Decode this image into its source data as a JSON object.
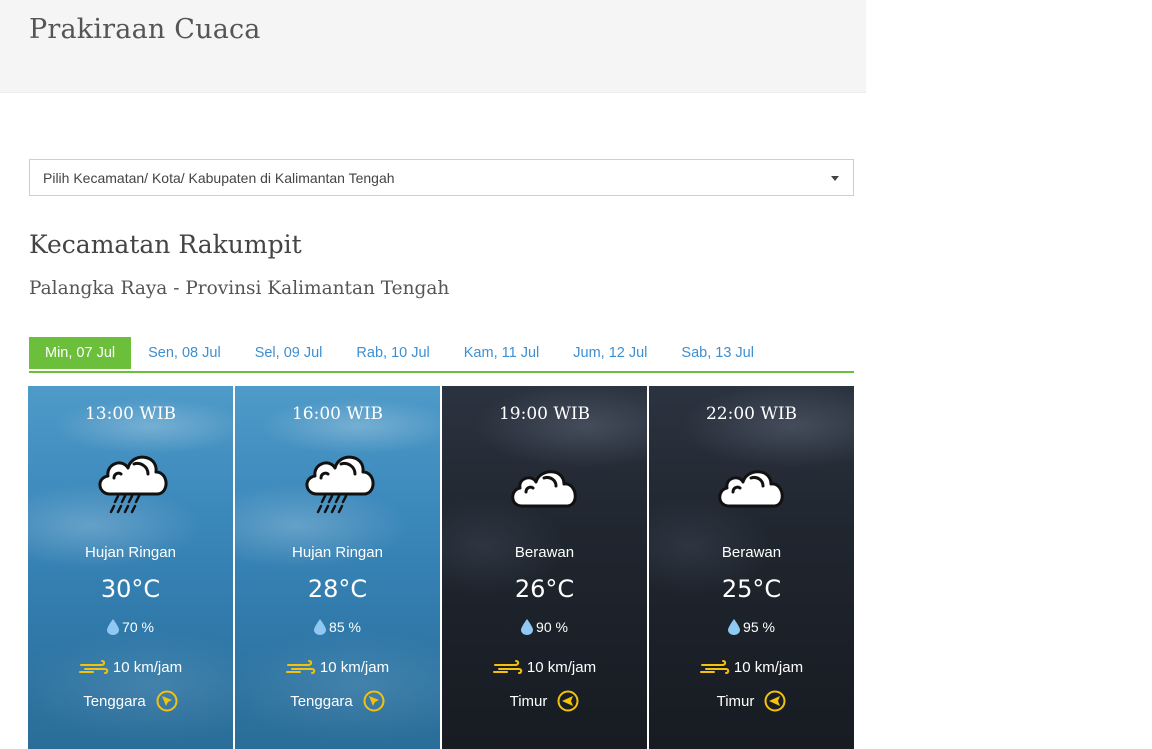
{
  "header": {
    "title": "Prakiraan Cuaca"
  },
  "location_select": {
    "selected": "Pilih Kecamatan/ Kota/ Kabupaten di Kalimantan Tengah"
  },
  "location": {
    "district": "Kecamatan Rakumpit",
    "region": "Palangka Raya - Provinsi Kalimantan Tengah"
  },
  "tabs": [
    {
      "label": "Min, 07 Jul",
      "active": true
    },
    {
      "label": "Sen, 08 Jul",
      "active": false
    },
    {
      "label": "Sel, 09 Jul",
      "active": false
    },
    {
      "label": "Rab, 10 Jul",
      "active": false
    },
    {
      "label": "Kam, 11 Jul",
      "active": false
    },
    {
      "label": "Jum, 12 Jul",
      "active": false
    },
    {
      "label": "Sab, 13 Jul",
      "active": false
    }
  ],
  "forecasts": [
    {
      "time": "13:00 WIB",
      "condition": "Hujan Ringan",
      "icon": "light-rain-icon",
      "temperature": "30°C",
      "humidity": "70 %",
      "wind_speed": "10 km/jam",
      "wind_direction": "Tenggara",
      "direction_icon": "compass-southeast-icon",
      "theme": "day"
    },
    {
      "time": "16:00 WIB",
      "condition": "Hujan Ringan",
      "icon": "light-rain-icon",
      "temperature": "28°C",
      "humidity": "85 %",
      "wind_speed": "10 km/jam",
      "wind_direction": "Tenggara",
      "direction_icon": "compass-southeast-icon",
      "theme": "day"
    },
    {
      "time": "19:00 WIB",
      "condition": "Berawan",
      "icon": "cloudy-icon",
      "temperature": "26°C",
      "humidity": "90 %",
      "wind_speed": "10 km/jam",
      "wind_direction": "Timur",
      "direction_icon": "compass-east-icon",
      "theme": "night"
    },
    {
      "time": "22:00 WIB",
      "condition": "Berawan",
      "icon": "cloudy-icon",
      "temperature": "25°C",
      "humidity": "95 %",
      "wind_speed": "10 km/jam",
      "wind_direction": "Timur",
      "direction_icon": "compass-east-icon",
      "theme": "night"
    }
  ],
  "colors": {
    "accent_green": "#6cbf3a",
    "tab_link_blue": "#3d8fd1",
    "wind_icon_yellow": "#f4c20d",
    "humidity_drop_blue": "#8fc8f2"
  }
}
